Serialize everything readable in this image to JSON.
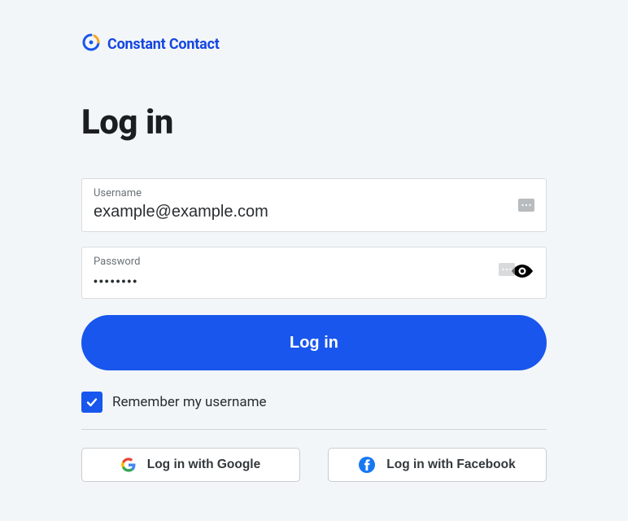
{
  "brand": {
    "name": "Constant Contact"
  },
  "page": {
    "title": "Log in"
  },
  "form": {
    "username_label": "Username",
    "username_value": "example@example.com",
    "password_label": "Password",
    "password_masked": "••••••••",
    "submit_label": "Log in",
    "remember_label": "Remember my username",
    "remember_checked": true
  },
  "social": {
    "google_label": "Log in with Google",
    "facebook_label": "Log in with Facebook"
  },
  "colors": {
    "primary": "#1856ed",
    "accent_orange": "#f5a623",
    "bg": "#f3f6f8"
  }
}
